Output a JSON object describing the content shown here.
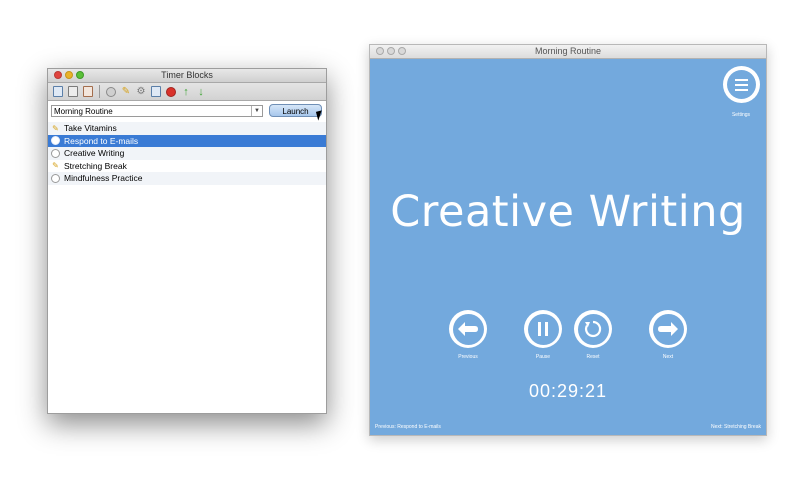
{
  "left_window": {
    "title": "Timer Blocks",
    "toolbar": {
      "icons": [
        "new-block-icon",
        "duplicate-icon",
        "import-icon",
        "zoom-icon",
        "broom-icon",
        "gear-icon",
        "copy-icon",
        "delete-icon",
        "move-up-icon",
        "move-down-icon"
      ]
    },
    "routine_select": {
      "value": "Morning Routine"
    },
    "launch_label": "Launch",
    "items": [
      {
        "label": "Take Vitamins",
        "icon": "broom-icon",
        "selected": false
      },
      {
        "label": "Respond to E-mails",
        "icon": "clock-icon",
        "selected": true
      },
      {
        "label": "Creative Writing",
        "icon": "clock-icon",
        "selected": false
      },
      {
        "label": "Stretching Break",
        "icon": "broom-icon",
        "selected": false
      },
      {
        "label": "Mindfulness Practice",
        "icon": "clock-icon",
        "selected": false
      }
    ]
  },
  "right_window": {
    "title": "Morning Routine",
    "settings_label": "Settings",
    "current_block": "Creative Writing",
    "controls": {
      "previous": "Previous",
      "pause": "Pause",
      "reset": "Reset",
      "next": "Next"
    },
    "timer": "00:29:21",
    "footer_previous": "Previous: Respond to E-mails",
    "footer_next": "Next: Stretching Break"
  },
  "colors": {
    "accent_blue": "#73a9dd",
    "selection_blue": "#3a7bd5"
  }
}
